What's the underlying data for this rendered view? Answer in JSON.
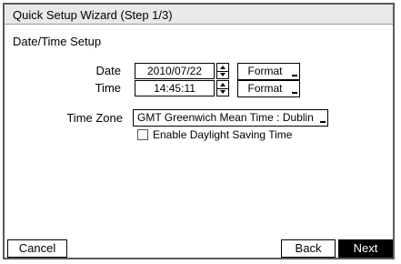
{
  "dialog": {
    "title": "Quick Setup Wizard (Step 1/3)",
    "section": "Date/Time Setup",
    "date": {
      "label": "Date",
      "value": "2010/07/22",
      "format_label": "Format"
    },
    "time": {
      "label": "Time",
      "value": "14:45:11",
      "format_label": "Format"
    },
    "timezone": {
      "label": "Time Zone",
      "value": "GMT  Greenwich Mean Time : Dublin"
    },
    "dst": {
      "label": "Enable Daylight Saving Time",
      "checked": false
    }
  },
  "footer": {
    "cancel_label": "Cancel",
    "back_label": "Back",
    "next_label": "Next"
  }
}
